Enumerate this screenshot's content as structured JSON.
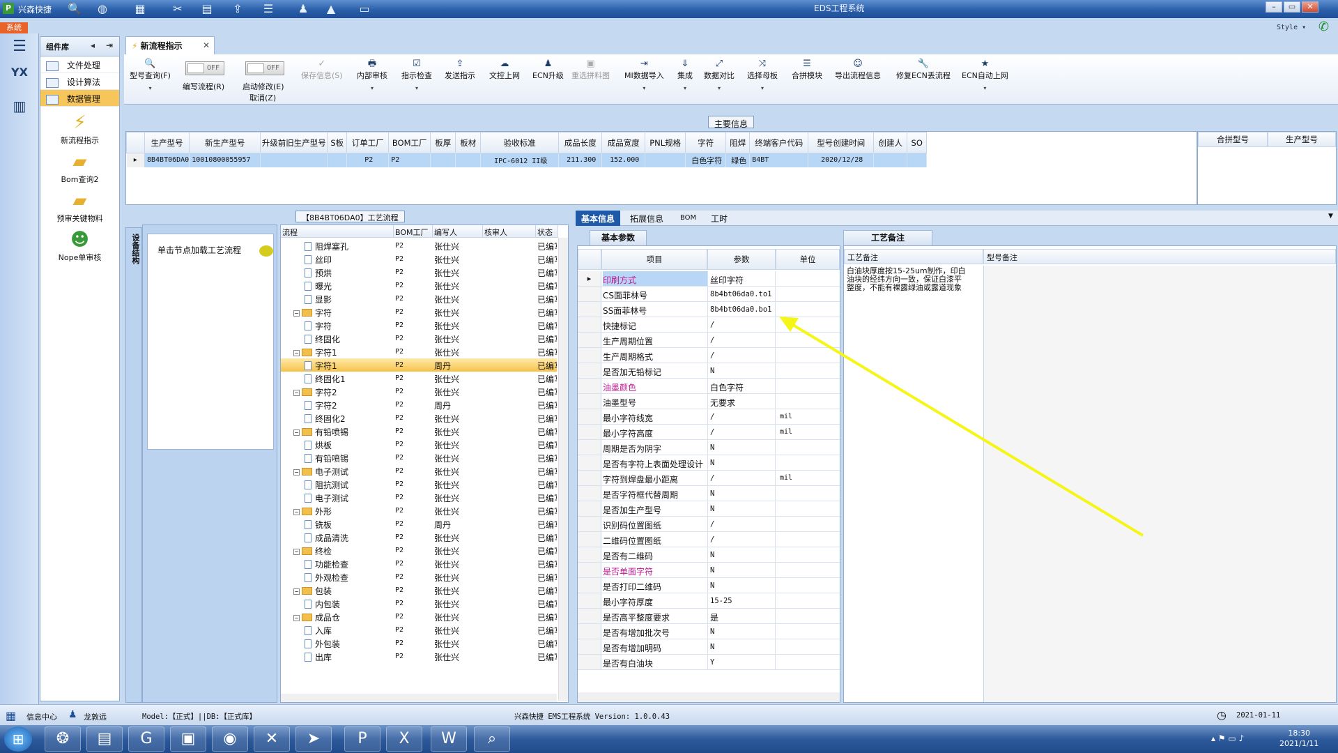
{
  "titlebar": {
    "app_name": "兴森快捷",
    "window_title": "EDS工程系统",
    "min": "–",
    "max": "▭",
    "close": "✕"
  },
  "sys_tab": "系统",
  "style_label": "Style ▾",
  "nav": {
    "header": "组件库",
    "items": [
      "文件处理",
      "设计算法",
      "数据管理"
    ],
    "big_items": [
      "新流程指示",
      "Bom查询2",
      "预审关键物料",
      "Nope单审核"
    ]
  },
  "doc_tab": "新流程指示",
  "toolbar": {
    "items": [
      {
        "label": "型号查询(F)",
        "icon": "🔍"
      },
      {
        "label": "编写流程(R)",
        "icon": ""
      },
      {
        "label": "启动修改(E)",
        "icon": ""
      },
      {
        "label": "保存信息(S)",
        "icon": "✓"
      },
      {
        "label": "内部审核",
        "icon": "🖶"
      },
      {
        "label": "指示检查",
        "icon": "☑"
      },
      {
        "label": "发送指示",
        "icon": "⇪"
      },
      {
        "label": "文控上网",
        "icon": "☁"
      },
      {
        "label": "ECN升级",
        "icon": "♟"
      },
      {
        "label": "重选拼料图",
        "icon": "▣"
      },
      {
        "label": "MI数据导入",
        "icon": "⇥"
      },
      {
        "label": "集成",
        "icon": "⇓"
      },
      {
        "label": "数据对比",
        "icon": "⤢"
      },
      {
        "label": "选择母板",
        "icon": "⤨"
      },
      {
        "label": "合拼模块",
        "icon": "☰"
      },
      {
        "label": "导出流程信息",
        "icon": "☺"
      },
      {
        "label": "修复ECN丢流程",
        "icon": "🔧"
      },
      {
        "label": "ECN自动上网",
        "icon": "★"
      }
    ],
    "toggle_off": "OFF",
    "cancel_label": "取消(Z)"
  },
  "main_info": {
    "label": "主要信息",
    "columns": [
      "生产型号",
      "新生产型号",
      "升级前旧生产型号",
      "S板",
      "订单工厂",
      "BOM工厂",
      "板厚",
      "板材",
      "验收标准",
      "成品长度",
      "成品宽度",
      "PNL规格",
      "字符",
      "阻焊",
      "终端客户代码",
      "型号创建时间",
      "创建人",
      "SO"
    ],
    "row": [
      "8B4BT06DA0",
      "10010800055957",
      "",
      "",
      "P2",
      "P2",
      "",
      "",
      "IPC-6012 II级",
      "211.300",
      "152.000",
      "",
      "白色字符",
      "绿色",
      "B4BT",
      "2020/12/28",
      "",
      ""
    ],
    "side_columns": [
      "合拼型号",
      "生产型号"
    ]
  },
  "process_title": "【8B4BT06DA0】工艺流程",
  "process_tab": "设备结构",
  "process_hint": "单击节点加载工艺流程",
  "tree": {
    "columns": [
      "流程",
      "BOM工厂",
      "编写人",
      "核审人",
      "状态"
    ],
    "rows": [
      {
        "name": "阻焊塞孔",
        "level": 2,
        "type": "page",
        "bom": "P2",
        "writer": "张仕兴",
        "status": "已编写"
      },
      {
        "name": "丝印",
        "level": 2,
        "type": "page",
        "bom": "P2",
        "writer": "张仕兴",
        "status": "已编写"
      },
      {
        "name": "预烘",
        "level": 2,
        "type": "page",
        "bom": "P2",
        "writer": "张仕兴",
        "status": "已编写"
      },
      {
        "name": "曝光",
        "level": 2,
        "type": "page",
        "bom": "P2",
        "writer": "张仕兴",
        "status": "已编写"
      },
      {
        "name": "显影",
        "level": 2,
        "type": "page",
        "bom": "P2",
        "writer": "张仕兴",
        "status": "已编写"
      },
      {
        "name": "字符",
        "level": 1,
        "type": "folder",
        "bom": "P2",
        "writer": "张仕兴",
        "status": "已编写"
      },
      {
        "name": "字符",
        "level": 2,
        "type": "page",
        "bom": "P2",
        "writer": "张仕兴",
        "status": "已编写"
      },
      {
        "name": "终固化",
        "level": 2,
        "type": "page",
        "bom": "P2",
        "writer": "张仕兴",
        "status": "已编写"
      },
      {
        "name": "字符1",
        "level": 1,
        "type": "folder",
        "bom": "P2",
        "writer": "张仕兴",
        "status": "已编写"
      },
      {
        "name": "字符1",
        "level": 2,
        "type": "page",
        "bom": "P2",
        "writer": "周丹",
        "status": "已编写",
        "selected": true
      },
      {
        "name": "终固化1",
        "level": 2,
        "type": "page",
        "bom": "P2",
        "writer": "张仕兴",
        "status": "已编写"
      },
      {
        "name": "字符2",
        "level": 1,
        "type": "folder",
        "bom": "P2",
        "writer": "张仕兴",
        "status": "已编写"
      },
      {
        "name": "字符2",
        "level": 2,
        "type": "page",
        "bom": "P2",
        "writer": "周丹",
        "status": "已编写"
      },
      {
        "name": "终固化2",
        "level": 2,
        "type": "page",
        "bom": "P2",
        "writer": "张仕兴",
        "status": "已编写"
      },
      {
        "name": "有铅喷锡",
        "level": 1,
        "type": "folder",
        "bom": "P2",
        "writer": "张仕兴",
        "status": "已编写"
      },
      {
        "name": "烘板",
        "level": 2,
        "type": "page",
        "bom": "P2",
        "writer": "张仕兴",
        "status": "已编写"
      },
      {
        "name": "有铅喷锡",
        "level": 2,
        "type": "page",
        "bom": "P2",
        "writer": "张仕兴",
        "status": "已编写"
      },
      {
        "name": "电子测试",
        "level": 1,
        "type": "folder",
        "bom": "P2",
        "writer": "张仕兴",
        "status": "已编写"
      },
      {
        "name": "阻抗测试",
        "level": 2,
        "type": "page",
        "bom": "P2",
        "writer": "张仕兴",
        "status": "已编写"
      },
      {
        "name": "电子测试",
        "level": 2,
        "type": "page",
        "bom": "P2",
        "writer": "张仕兴",
        "status": "已编写"
      },
      {
        "name": "外形",
        "level": 1,
        "type": "folder",
        "bom": "P2",
        "writer": "张仕兴",
        "status": "已编写"
      },
      {
        "name": "铣板",
        "level": 2,
        "type": "page",
        "bom": "P2",
        "writer": "周丹",
        "status": "已编写"
      },
      {
        "name": "成品清洗",
        "level": 2,
        "type": "page",
        "bom": "P2",
        "writer": "张仕兴",
        "status": "已编写"
      },
      {
        "name": "终检",
        "level": 1,
        "type": "folder",
        "bom": "P2",
        "writer": "张仕兴",
        "status": "已编写"
      },
      {
        "name": "功能检查",
        "level": 2,
        "type": "page",
        "bom": "P2",
        "writer": "张仕兴",
        "status": "已编写"
      },
      {
        "name": "外观检查",
        "level": 2,
        "type": "page",
        "bom": "P2",
        "writer": "张仕兴",
        "status": "已编写"
      },
      {
        "name": "包装",
        "level": 1,
        "type": "folder",
        "bom": "P2",
        "writer": "张仕兴",
        "status": "已编写"
      },
      {
        "name": "内包装",
        "level": 2,
        "type": "page",
        "bom": "P2",
        "writer": "张仕兴",
        "status": "已编写"
      },
      {
        "name": "成品仓",
        "level": 1,
        "type": "folder",
        "bom": "P2",
        "writer": "张仕兴",
        "status": "已编写"
      },
      {
        "name": "入库",
        "level": 2,
        "type": "page",
        "bom": "P2",
        "writer": "张仕兴",
        "status": "已编写"
      },
      {
        "name": "外包装",
        "level": 2,
        "type": "page",
        "bom": "P2",
        "writer": "张仕兴",
        "status": "已编写"
      },
      {
        "name": "出库",
        "level": 2,
        "type": "page",
        "bom": "P2",
        "writer": "张仕兴",
        "status": "已编写"
      }
    ]
  },
  "info_tabs": [
    "基本信息",
    "拓展信息",
    "BOM",
    "工时"
  ],
  "params": {
    "subtab": "基本参数",
    "columns": [
      "项目",
      "参数",
      "单位"
    ],
    "rows": [
      {
        "item": "印刷方式",
        "value": "丝印字符",
        "unit": "",
        "hl": true
      },
      {
        "item": "CS面菲林号",
        "value": "8b4bt06da0.to1",
        "unit": ""
      },
      {
        "item": "SS面菲林号",
        "value": "8b4bt06da0.bo1",
        "unit": ""
      },
      {
        "item": "快捷标记",
        "value": "/",
        "unit": ""
      },
      {
        "item": "生产周期位置",
        "value": "/",
        "unit": ""
      },
      {
        "item": "生产周期格式",
        "value": "/",
        "unit": ""
      },
      {
        "item": "是否加无铅标记",
        "value": "N",
        "unit": ""
      },
      {
        "item": "油墨颜色",
        "value": "白色字符",
        "unit": "",
        "hl": true
      },
      {
        "item": "油墨型号",
        "value": "无要求",
        "unit": ""
      },
      {
        "item": "最小字符线宽",
        "value": "/",
        "unit": "mil"
      },
      {
        "item": "最小字符高度",
        "value": "/",
        "unit": "mil"
      },
      {
        "item": "周期是否为阴字",
        "value": "N",
        "unit": ""
      },
      {
        "item": "是否有字符上表面处理设计",
        "value": "N",
        "unit": ""
      },
      {
        "item": "字符到焊盘最小距离",
        "value": "/",
        "unit": "mil"
      },
      {
        "item": "是否字符框代替周期",
        "value": "N",
        "unit": ""
      },
      {
        "item": "是否加生产型号",
        "value": "N",
        "unit": ""
      },
      {
        "item": "识别码位置图纸",
        "value": "/",
        "unit": ""
      },
      {
        "item": "二维码位置图纸",
        "value": "/",
        "unit": ""
      },
      {
        "item": "是否有二维码",
        "value": "N",
        "unit": ""
      },
      {
        "item": "是否单面字符",
        "value": "N",
        "unit": "",
        "hl": true
      },
      {
        "item": "是否打印二维码",
        "value": "N",
        "unit": ""
      },
      {
        "item": "最小字符厚度",
        "value": "15-25",
        "unit": ""
      },
      {
        "item": "是否高平整度要求",
        "value": "是",
        "unit": ""
      },
      {
        "item": "是否有增加批次号",
        "value": "N",
        "unit": ""
      },
      {
        "item": "是否有增加明码",
        "value": "N",
        "unit": ""
      },
      {
        "item": "是否有白油块",
        "value": "Y",
        "unit": ""
      }
    ]
  },
  "notes": {
    "tab": "工艺备注",
    "columns": [
      "工艺备注",
      "型号备注"
    ],
    "text": "白油块厚度按15-25um制作，印白油块的经纬方向一致，保证白漆平整度，不能有裸露绿油或露道现象"
  },
  "status": {
    "info_center": "信息中心",
    "user": "龙敦远",
    "model": "Model:【正式】||DB:【正式库】",
    "version": "兴森快捷 EMS工程系统 Version: 1.0.0.43",
    "date": "2021-01-11"
  },
  "taskbar": {
    "time": "18:30",
    "date": "2021/1/11"
  },
  "colors": {
    "accent": "#1e5aa8",
    "selected_row": "#f6c24a",
    "highlight_text": "#c01890",
    "arrow": "#f5f516"
  }
}
